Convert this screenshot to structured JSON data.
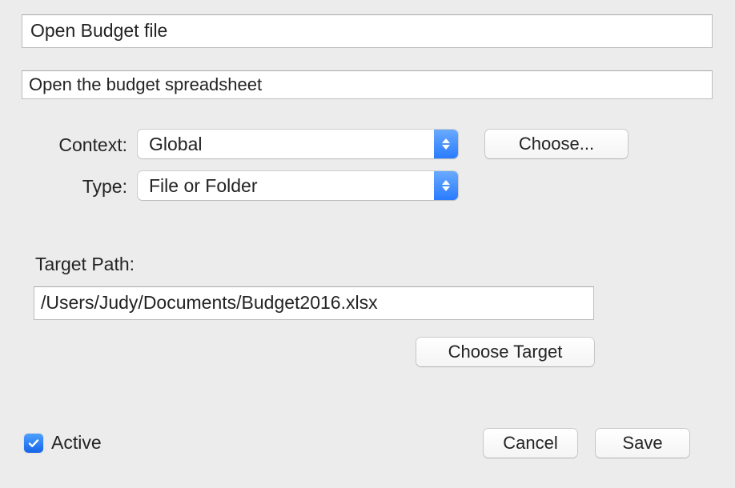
{
  "name_field": "Open Budget file",
  "description_field": "Open the budget spreadsheet",
  "labels": {
    "context": "Context:",
    "type": "Type:",
    "target_path": "Target Path:"
  },
  "context_select": "Global",
  "type_select": "File or Folder",
  "buttons": {
    "choose": "Choose...",
    "choose_target": "Choose Target",
    "cancel": "Cancel",
    "save": "Save"
  },
  "target_path": "/Users/Judy/Documents/Budget2016.xlsx",
  "active_checkbox": {
    "label": "Active",
    "checked": true
  }
}
